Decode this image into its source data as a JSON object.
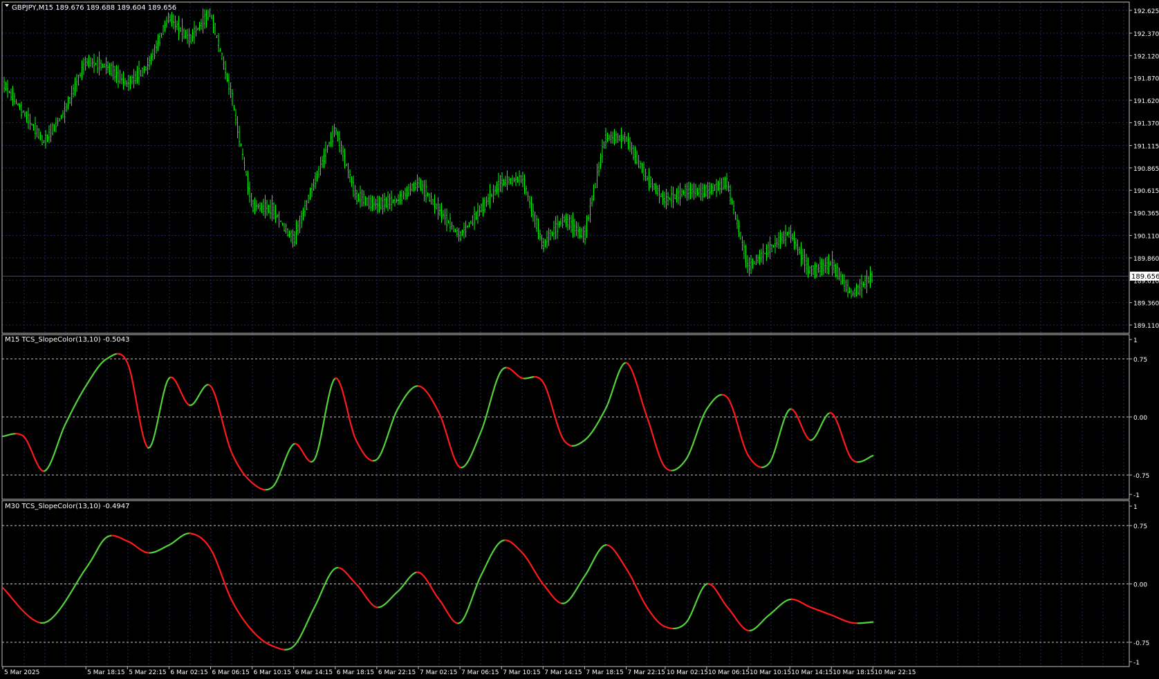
{
  "window": {
    "symbol_header": "GBPJPY,M15  189.676 189.688 189.604 189.656"
  },
  "panels": {
    "indicator1_label": "M15 TCS_SlopeColor(13,10) -0.5043",
    "indicator2_label": "M30 TCS_SlopeColor(13,10) -0.4947"
  },
  "colors": {
    "background": "#000000",
    "grid": "#1f2a5a",
    "frame": "#c0c0c0",
    "price_series": "#00ff00",
    "slope_up": "#53d23a",
    "slope_down": "#ff1a1a",
    "level_line": "#c8c8c8",
    "current_price_line": "#4040a0",
    "text": "#ffffff"
  },
  "chart_data": [
    {
      "type": "bar",
      "subtype": "ohlc",
      "timeframe": "M15",
      "y_ticks": [
        "192.625",
        "192.370",
        "192.120",
        "191.870",
        "191.620",
        "191.370",
        "191.115",
        "190.865",
        "190.615",
        "190.365",
        "190.110",
        "189.860",
        "189.610",
        "189.360",
        "189.110"
      ],
      "ylim": [
        189.11,
        192.625
      ],
      "current_price": "189.656",
      "x_ticks": [
        "5 Mar 2025",
        "5 Mar 18:15",
        "5 Mar 22:15",
        "6 Mar 02:15",
        "6 Mar 06:15",
        "6 Mar 10:15",
        "6 Mar 14:15",
        "6 Mar 18:15",
        "6 Mar 22:15",
        "7 Mar 02:15",
        "7 Mar 06:15",
        "7 Mar 10:15",
        "7 Mar 14:15",
        "7 Mar 18:15",
        "7 Mar 22:15",
        "10 Mar 02:15",
        "10 Mar 06:15",
        "10 Mar 10:15",
        "10 Mar 14:15",
        "10 Mar 18:15",
        "10 Mar 22:15"
      ],
      "path": [
        [
          "5 Mar 2025",
          191.82
        ],
        [
          "5 Mar 14:15",
          191.15
        ],
        [
          "5 Mar 16:15",
          191.5
        ],
        [
          "5 Mar 18:15",
          192.05
        ],
        [
          "5 Mar 20:15",
          192.0
        ],
        [
          "5 Mar 22:15",
          191.8
        ],
        [
          "6 Mar 00:15",
          192.0
        ],
        [
          "6 Mar 02:15",
          192.55
        ],
        [
          "6 Mar 04:15",
          192.3
        ],
        [
          "6 Mar 06:15",
          192.6
        ],
        [
          "6 Mar 08:15",
          191.7
        ],
        [
          "6 Mar 10:15",
          190.45
        ],
        [
          "6 Mar 12:15",
          190.4
        ],
        [
          "6 Mar 14:15",
          190.05
        ],
        [
          "6 Mar 16:15",
          190.7
        ],
        [
          "6 Mar 18:15",
          191.3
        ],
        [
          "6 Mar 20:15",
          190.55
        ],
        [
          "6 Mar 22:15",
          190.45
        ],
        [
          "7 Mar 00:15",
          190.5
        ],
        [
          "7 Mar 02:15",
          190.7
        ],
        [
          "7 Mar 04:15",
          190.4
        ],
        [
          "7 Mar 06:15",
          190.1
        ],
        [
          "7 Mar 08:15",
          190.4
        ],
        [
          "7 Mar 10:15",
          190.7
        ],
        [
          "7 Mar 12:15",
          190.75
        ],
        [
          "7 Mar 14:15",
          190.0
        ],
        [
          "7 Mar 16:15",
          190.3
        ],
        [
          "7 Mar 18:15",
          190.1
        ],
        [
          "7 Mar 20:15",
          191.2
        ],
        [
          "7 Mar 22:15",
          191.2
        ],
        [
          "8 Mar 00:15",
          190.75
        ],
        [
          "10 Mar 02:15",
          190.5
        ],
        [
          "10 Mar 04:15",
          190.6
        ],
        [
          "10 Mar 06:15",
          190.6
        ],
        [
          "10 Mar 08:15",
          190.7
        ],
        [
          "10 Mar 10:15",
          189.75
        ],
        [
          "10 Mar 12:15",
          189.95
        ],
        [
          "10 Mar 14:15",
          190.15
        ],
        [
          "10 Mar 16:15",
          189.7
        ],
        [
          "10 Mar 18:15",
          189.8
        ],
        [
          "10 Mar 20:15",
          189.45
        ],
        [
          "10 Mar 22:15",
          189.66
        ]
      ]
    },
    {
      "type": "line",
      "name": "M15 TCS_SlopeColor(13,10) -0.5043",
      "y_ticks": [
        "1",
        "0.75",
        "0.00",
        "-0.75",
        "-1"
      ],
      "ylim": [
        -1,
        1
      ],
      "levels": [
        0.75,
        0,
        -0.75
      ],
      "x_ticks": [
        "5 Mar 2025",
        "5 Mar 18:15",
        "5 Mar 22:15",
        "6 Mar 02:15",
        "6 Mar 06:15",
        "6 Mar 10:15",
        "6 Mar 14:15",
        "6 Mar 18:15",
        "6 Mar 22:15",
        "7 Mar 02:15",
        "7 Mar 06:15",
        "7 Mar 10:15",
        "7 Mar 14:15",
        "7 Mar 18:15",
        "7 Mar 22:15",
        "10 Mar 02:15",
        "10 Mar 06:15",
        "10 Mar 10:15",
        "10 Mar 14:15",
        "10 Mar 18:15",
        "10 Mar 22:15"
      ],
      "points": [
        [
          "5 Mar 2025",
          -0.25
        ],
        [
          "5 Mar 12:15",
          -0.25
        ],
        [
          "5 Mar 14:15",
          -0.7
        ],
        [
          "5 Mar 16:15",
          -0.1
        ],
        [
          "5 Mar 18:15",
          0.4
        ],
        [
          "5 Mar 20:15",
          0.75
        ],
        [
          "5 Mar 22:15",
          0.7
        ],
        [
          "6 Mar 00:15",
          -0.4
        ],
        [
          "6 Mar 02:15",
          0.5
        ],
        [
          "6 Mar 04:15",
          0.15
        ],
        [
          "6 Mar 06:15",
          0.4
        ],
        [
          "6 Mar 08:15",
          -0.45
        ],
        [
          "6 Mar 10:15",
          -0.85
        ],
        [
          "6 Mar 12:15",
          -0.9
        ],
        [
          "6 Mar 14:15",
          -0.35
        ],
        [
          "6 Mar 16:15",
          -0.55
        ],
        [
          "6 Mar 18:15",
          0.5
        ],
        [
          "6 Mar 20:15",
          -0.3
        ],
        [
          "6 Mar 22:15",
          -0.55
        ],
        [
          "7 Mar 00:15",
          0.1
        ],
        [
          "7 Mar 02:15",
          0.4
        ],
        [
          "7 Mar 04:15",
          0.05
        ],
        [
          "7 Mar 06:15",
          -0.65
        ],
        [
          "7 Mar 08:15",
          -0.2
        ],
        [
          "7 Mar 10:15",
          0.6
        ],
        [
          "7 Mar 12:15",
          0.5
        ],
        [
          "7 Mar 14:15",
          0.45
        ],
        [
          "7 Mar 16:15",
          -0.3
        ],
        [
          "7 Mar 18:15",
          -0.3
        ],
        [
          "7 Mar 20:15",
          0.1
        ],
        [
          "7 Mar 22:15",
          0.7
        ],
        [
          "8 Mar 00:15",
          0.0
        ],
        [
          "10 Mar 02:15",
          -0.65
        ],
        [
          "10 Mar 04:15",
          -0.55
        ],
        [
          "10 Mar 06:15",
          0.1
        ],
        [
          "10 Mar 08:15",
          0.25
        ],
        [
          "10 Mar 10:15",
          -0.5
        ],
        [
          "10 Mar 12:15",
          -0.6
        ],
        [
          "10 Mar 14:15",
          0.1
        ],
        [
          "10 Mar 16:15",
          -0.3
        ],
        [
          "10 Mar 18:15",
          0.05
        ],
        [
          "10 Mar 20:15",
          -0.55
        ],
        [
          "10 Mar 22:15",
          -0.5
        ]
      ]
    },
    {
      "type": "line",
      "name": "M30 TCS_SlopeColor(13,10) -0.4947",
      "y_ticks": [
        "1",
        "0.75",
        "0.00",
        "-0.75",
        "-1"
      ],
      "ylim": [
        -1,
        1
      ],
      "levels": [
        0.75,
        0,
        -0.75
      ],
      "x_ticks": [
        "5 Mar 2025",
        "5 Mar 18:15",
        "5 Mar 22:15",
        "6 Mar 02:15",
        "6 Mar 06:15",
        "6 Mar 10:15",
        "6 Mar 14:15",
        "6 Mar 18:15",
        "6 Mar 22:15",
        "7 Mar 02:15",
        "7 Mar 06:15",
        "7 Mar 10:15",
        "7 Mar 14:15",
        "7 Mar 18:15",
        "7 Mar 22:15",
        "10 Mar 02:15",
        "10 Mar 06:15",
        "10 Mar 10:15",
        "10 Mar 14:15",
        "10 Mar 18:15",
        "10 Mar 22:15"
      ],
      "points": [
        [
          "5 Mar 2025",
          -0.05
        ],
        [
          "5 Mar 14:15",
          -0.5
        ],
        [
          "5 Mar 18:15",
          0.2
        ],
        [
          "5 Mar 20:15",
          0.6
        ],
        [
          "5 Mar 22:15",
          0.55
        ],
        [
          "6 Mar 00:15",
          0.4
        ],
        [
          "6 Mar 02:15",
          0.5
        ],
        [
          "6 Mar 04:15",
          0.65
        ],
        [
          "6 Mar 06:15",
          0.45
        ],
        [
          "6 Mar 08:15",
          -0.2
        ],
        [
          "6 Mar 10:15",
          -0.6
        ],
        [
          "6 Mar 12:15",
          -0.8
        ],
        [
          "6 Mar 14:15",
          -0.8
        ],
        [
          "6 Mar 16:15",
          -0.3
        ],
        [
          "6 Mar 18:15",
          0.2
        ],
        [
          "6 Mar 20:15",
          0.0
        ],
        [
          "6 Mar 22:15",
          -0.3
        ],
        [
          "7 Mar 00:15",
          -0.1
        ],
        [
          "7 Mar 02:15",
          0.15
        ],
        [
          "7 Mar 04:15",
          -0.2
        ],
        [
          "7 Mar 06:15",
          -0.5
        ],
        [
          "7 Mar 08:15",
          0.1
        ],
        [
          "7 Mar 10:15",
          0.55
        ],
        [
          "7 Mar 12:15",
          0.4
        ],
        [
          "7 Mar 14:15",
          0.0
        ],
        [
          "7 Mar 16:15",
          -0.25
        ],
        [
          "7 Mar 18:15",
          0.1
        ],
        [
          "7 Mar 20:15",
          0.5
        ],
        [
          "7 Mar 22:15",
          0.2
        ],
        [
          "8 Mar 00:15",
          -0.3
        ],
        [
          "10 Mar 02:15",
          -0.55
        ],
        [
          "10 Mar 04:15",
          -0.5
        ],
        [
          "10 Mar 06:15",
          0.0
        ],
        [
          "10 Mar 08:15",
          -0.3
        ],
        [
          "10 Mar 10:15",
          -0.6
        ],
        [
          "10 Mar 12:15",
          -0.4
        ],
        [
          "10 Mar 14:15",
          -0.2
        ],
        [
          "10 Mar 16:15",
          -0.3
        ],
        [
          "10 Mar 18:15",
          -0.4
        ],
        [
          "10 Mar 20:15",
          -0.5
        ],
        [
          "10 Mar 22:15",
          -0.49
        ]
      ]
    }
  ]
}
